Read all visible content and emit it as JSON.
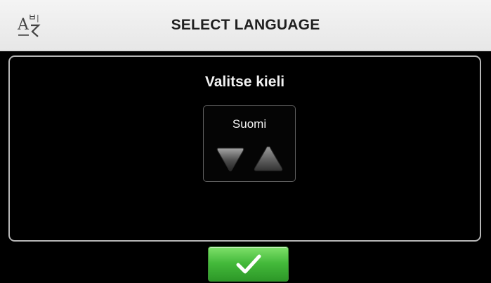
{
  "header": {
    "title": "SELECT LANGUAGE",
    "icon": "language-icon"
  },
  "panel": {
    "title": "Valitse kieli",
    "selected_language": "Suomi",
    "down_icon": "triangle-down-icon",
    "up_icon": "triangle-up-icon"
  },
  "footer": {
    "confirm_icon": "checkmark-icon"
  },
  "colors": {
    "header_bg": "#ececec",
    "panel_border": "#b6b6b6",
    "confirm_green": "#43b93a",
    "text_light": "#f2f2f2"
  }
}
